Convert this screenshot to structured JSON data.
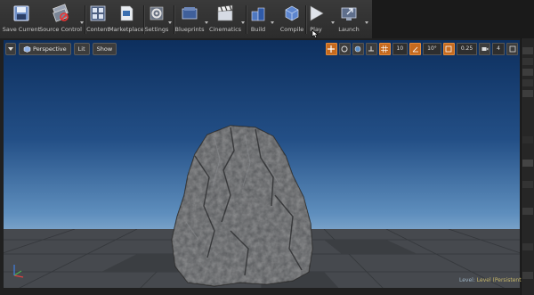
{
  "toolbar": {
    "items": [
      {
        "label": "Save Current",
        "icon": "save-icon"
      },
      {
        "label": "Source Control",
        "icon": "source-control-icon"
      },
      {
        "label": "Content",
        "icon": "content-browser-icon"
      },
      {
        "label": "Marketplace",
        "icon": "marketplace-icon"
      },
      {
        "label": "Settings",
        "icon": "settings-icon"
      },
      {
        "label": "Blueprints",
        "icon": "blueprints-icon"
      },
      {
        "label": "Cinematics",
        "icon": "cinematics-icon"
      },
      {
        "label": "Build",
        "icon": "build-icon"
      },
      {
        "label": "Compile",
        "icon": "compile-icon"
      },
      {
        "label": "Play",
        "icon": "play-icon"
      },
      {
        "label": "Launch",
        "icon": "launch-icon"
      }
    ]
  },
  "viewport": {
    "view_mode": "Perspective",
    "lighting": "Lit",
    "show": "Show",
    "grid_snap": "10",
    "rotation_snap": "10°",
    "scale_snap": "0.25",
    "camera_speed": "4",
    "level_prefix": "Level:",
    "level_name": "Level (Persistent)",
    "colors": {
      "sky_top": "#0d2f5e",
      "horizon": "#9fb9cf",
      "ground": "#404348",
      "accent": "#c66a1e"
    }
  }
}
